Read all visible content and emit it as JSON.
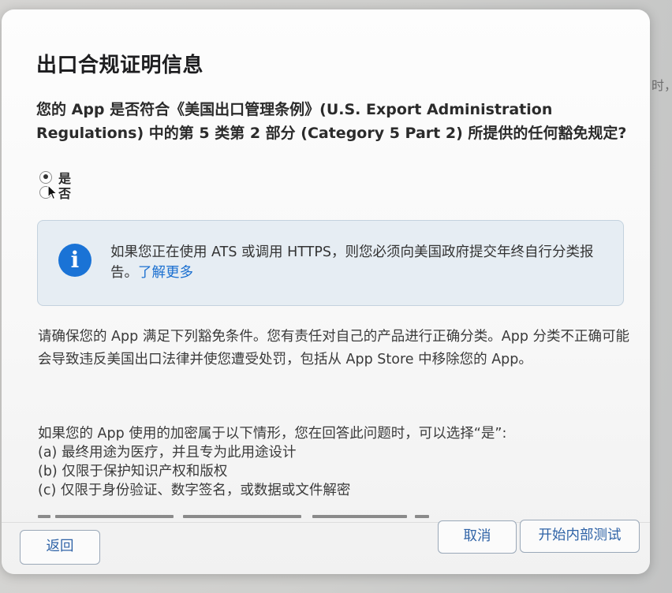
{
  "background": {
    "edge_text": "时，"
  },
  "dialog": {
    "title": "出口合规证明信息",
    "question": "您的 App 是否符合《美国出口管理条例》(U.S. Export Administration Regulations) 中的第 5 类第 2 部分 (Category 5 Part 2) 所提供的任何豁免规定?",
    "options": [
      {
        "label": "是",
        "selected": true
      },
      {
        "label": "否",
        "selected": false
      }
    ],
    "info": {
      "icon": "info-icon",
      "text": "如果您正在使用 ATS 或调用 HTTPS，则您必须向美国政府提交年终自行分类报告。",
      "link": "了解更多"
    },
    "paragraph": "请确保您的 App 满足下列豁免条件。您有责任对自己的产品进行正确分类。App 分类不正确可能会导致违反美国出口法律并使您遭受处罚，包括从 App Store 中移除您的 App。",
    "criteria_intro": "如果您的 App 使用的加密属于以下情形，您在回答此问题时，可以选择“是”:",
    "criteria": [
      "(a) 最终用途为医疗，并且专为此用途设计",
      "(b) 仅限于保护知识产权和版权",
      "(c) 仅限于身份验证、数字签名，或数据或文件解密"
    ]
  },
  "footer": {
    "back_label": "返回",
    "cancel_label": "取消",
    "start_label": "开始内部测试"
  },
  "colors": {
    "accent": "#1a73d6",
    "link": "#1a6fd0",
    "button_text": "#2f63a7",
    "info_background": "#e6edf3"
  }
}
